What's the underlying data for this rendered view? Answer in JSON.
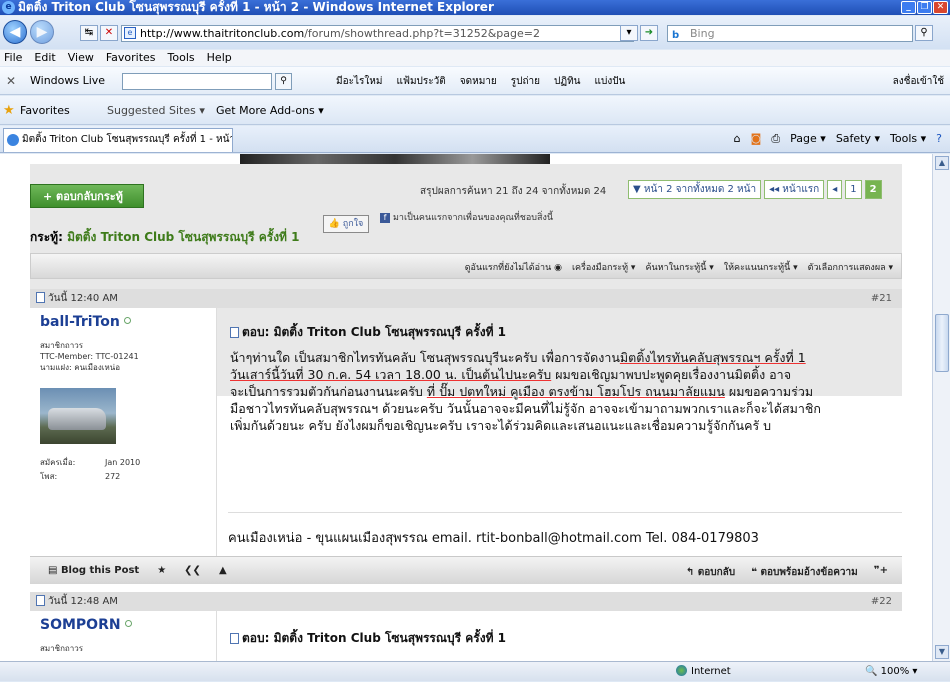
{
  "window": {
    "title": "มิตติ้ง Triton Club โซนสุพรรณบุรี ครั้งที่ 1 - หน้า 2 - Windows Internet Explorer",
    "minimize": "_",
    "restore": "❐",
    "close": "✕"
  },
  "address": {
    "host": "http://www.thaitritonclub.com",
    "path": "/forum/showthread.php?t=31252&page=2",
    "search_placeholder": "Bing"
  },
  "menu": [
    "File",
    "Edit",
    "View",
    "Favorites",
    "Tools",
    "Help"
  ],
  "windows_live": {
    "label": "Windows Live",
    "items": [
      "มีอะไรใหม่",
      "แฟ้มประวัติ",
      "จดหมาย",
      "รูปถ่าย",
      "ปฏิทิน",
      "แบ่งปัน"
    ],
    "signin": "ลงชื่อเข้าใช้"
  },
  "favorites": {
    "label": "Favorites",
    "suggested": "Suggested Sites ▾",
    "addons": "Get More Add-ons ▾"
  },
  "tab": {
    "label": "มิตติ้ง Triton Club โซนสุพรรณบุรี ครั้งที่ 1 - หน้า 2"
  },
  "command_bar": [
    "Page ▾",
    "Safety ▾",
    "Tools ▾"
  ],
  "thread": {
    "reply_button": "+ ตอบกลับกระทู้",
    "results_text": "สรุปผลการค้นหา 21 ถึง 24 จากทั้งหมด 24",
    "pager": {
      "page_info": "▼ หน้า 2 จากทั้งหมด 2 หน้า",
      "first": "◂◂ หน้าแรก",
      "prev": "◂",
      "p1": "1",
      "p2": "2"
    },
    "title_label": "กระทู้:",
    "title": "มิตติ้ง Triton Club โซนสุพรรณบุรี ครั้งที่ 1",
    "like_button": "ถูกใจ",
    "fb_text": "มาเป็นคนแรกจากเพื่อนของคุณที่ชอบสิ่งนี้",
    "tools": [
      "ดูอันแรกที่ยังไม่ได้อ่าน ◉",
      "เครื่องมือกระทู้ ▾",
      "ค้นหาในกระทู้นี้ ▾",
      "ให้คะแนนกระทู้นี้ ▾",
      "ตัวเลือกการแสดงผล ▾"
    ]
  },
  "posts": [
    {
      "date": "วันนี้ 12:40 AM",
      "number": "#21",
      "username": "ball-TriTon",
      "role": "สมาชิกถาวร",
      "member_id": "TTC-Member: TTC-01241",
      "alias": "นามแฝง: คนเมืองเหน่อ",
      "joined_label": "สมัครเมื่อ:",
      "joined": "Jan 2010",
      "posts_label": "โพส:",
      "post_count": "272",
      "title": "ตอบ: มิตติ้ง Triton Club โซนสุพรรณบุรี ครั้งที่ 1",
      "body_line1_a": "น้าๆท่านใด เป็นสมาชิกไทรทันคลับ โซนสุพรรณบุรีนะครับ เพื่อการจัดงาน",
      "body_line1_u": "มิตติ้งไทรทันคลับสุพรรณฯ ครั้งที่ 1",
      "body_line2_u": "วันเสาร์นี้วันที่ 30 ก.ค. 54 เวลา 18.00 น. เป็นต้นไปนะครับ",
      "body_line2_b": " ผมขอเชิญมาพบปะพูดคุยเรื่องงานมิตติ้ง อาจ",
      "body_line3_a": "จะเป็นการรวมตัวกันก่อนงานนะครับ ",
      "body_line3_u": "ที่ ปั๊ม ปตทใหม่ คูเมือง ตรงข้าม โฮมโปร ถนนมาลัยแมน",
      "body_line3_b": " ผมขอความร่วม",
      "body_line4": "มือชาวไทรทันคลับสุพรรณฯ ด้วยนะครับ วันนั้นอาจจะมีคนที่ไม่รู้จัก อาจจะเข้ามาถามพวกเราและก็จะได้สมาชิก",
      "body_line5": "เพิ่มกันด้วยนะ ครับ ยังไงผมก็ขอเชิญนะครับ เราจะได้ร่วมคิดและเสนอแนะและเชื่อมความรู้จักกันครั บ",
      "signature": "คนเมืองเหน่อ - ขุนแผนเมืองสุพรรณ email. rtit-bonball@hotmail.com Tel. 084-0179803",
      "blog": "Blog this Post",
      "reply": "ตอบกลับ",
      "quote_reply": "ตอบพร้อมอ้างข้อความ"
    },
    {
      "date": "วันนี้ 12:48 AM",
      "number": "#22",
      "username": "SOMPORN",
      "role": "สมาชิกถาวร",
      "title": "ตอบ: มิตติ้ง Triton Club โซนสุพรรณบุรี ครั้งที่ 1"
    }
  ],
  "status": {
    "zone": "Internet",
    "zoom": "100%"
  },
  "colors": {
    "titlebar": "#1f4fb5",
    "accent_green": "#3e7b1a",
    "username_blue": "#1c3f94"
  }
}
